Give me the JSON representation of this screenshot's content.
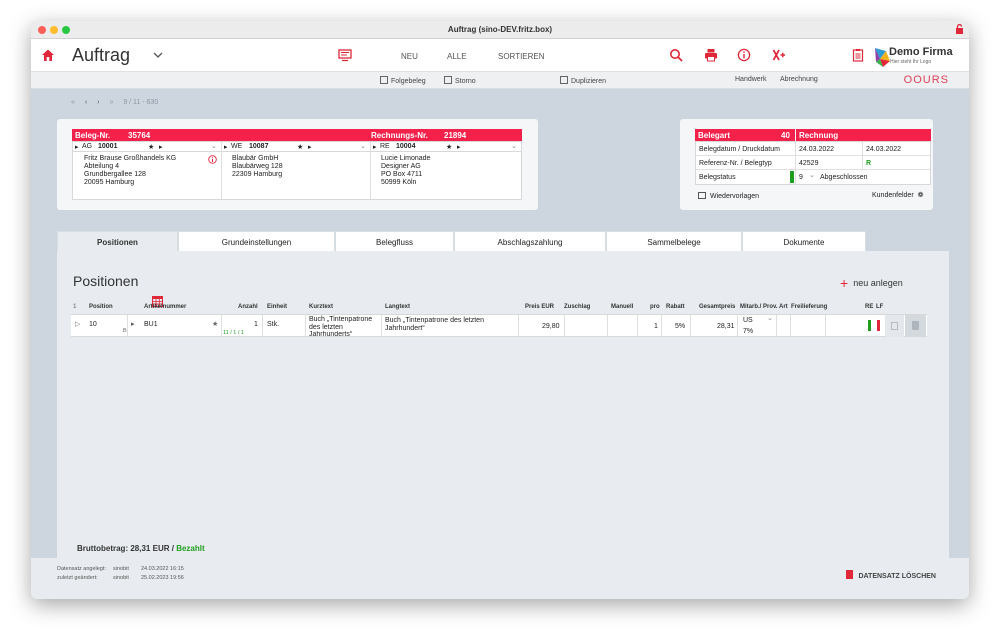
{
  "window": {
    "title": "Auftrag (sino-DEV.fritz.box)"
  },
  "toolbar": {
    "app_title": "Auftrag",
    "neu": "NEU",
    "alle": "ALLE",
    "sortieren": "SORTIEREN",
    "logo_name": "Demo Firma",
    "logo_tagline": "Hier steht Ihr Logo"
  },
  "subbar": {
    "folgebeleg": "Folgebeleg",
    "storno": "Storno",
    "duplizieren": "Duplizieren",
    "handwerk": "Handwerk",
    "abrechnung": "Abrechnung",
    "brand": "OOURS"
  },
  "pager": {
    "counter": "9 / 11 - 630"
  },
  "beleg": {
    "beleg_label": "Beleg-Nr.",
    "beleg_nr": "35764",
    "rechnung_label": "Rechnungs-Nr.",
    "rechnung_nr": "21894"
  },
  "addresses": [
    {
      "role": "AG",
      "number": "10001",
      "lines": [
        "Fritz Brause Großhandels KG",
        "Abteilung 4",
        "Grundbergallee 128",
        "20095 Hamburg"
      ]
    },
    {
      "role": "WE",
      "number": "10087",
      "lines": [
        "Blaubär GmbH",
        "Blaubärweg 128",
        "22309 Hamburg"
      ]
    },
    {
      "role": "RE",
      "number": "10004",
      "lines": [
        "Lucie Limonade",
        "Designer AG",
        "PO Box 4711",
        "50999 Köln"
      ]
    }
  ],
  "belegart": {
    "label": "Belegart",
    "number": "40",
    "type": "Rechnung",
    "datum_label": "Belegdatum / Druckdatum",
    "belegdatum": "24.03.2022",
    "druckdatum": "24.03.2022",
    "ref_label": "Referenz-Nr. / Belegtyp",
    "ref_nr": "42529",
    "belegtyp": "R",
    "status_label": "Belegstatus",
    "status_value": "9",
    "status_text": "Abgeschlossen",
    "wiedervorlagen": "Wiedervorlagen",
    "kundenfelder": "Kundenfelder"
  },
  "tabs": [
    "Positionen",
    "Grundeinstellungen",
    "Belegfluss",
    "Abschlagszahlung",
    "Sammelbelege",
    "Dokumente"
  ],
  "positions": {
    "title": "Positionen",
    "new_label": "neu anlegen",
    "columns": [
      "1",
      "Position",
      "Artikelnummer",
      "Anzahl",
      "Einheit",
      "Kurztext",
      "Langtext",
      "Preis EUR",
      "Zuschlag",
      "Manuell",
      "pro",
      "Rabatt",
      "Gesamtpreis",
      "Mitarb./ Prov.",
      "Art",
      "Freilieferung",
      "RE",
      "LF"
    ],
    "row": {
      "position": "10",
      "position_sub": "B",
      "artikel": "BU1",
      "anzahl": "1",
      "anzahl_sub": "11 / 1 / 1",
      "einheit": "Stk.",
      "kurztext_lines": [
        "Buch „Tintenpatrone",
        "des letzten",
        "Jahrhunderts“"
      ],
      "langtext_lines": [
        "Buch „Tintenpatrone des letzten",
        "Jahrhundert“"
      ],
      "preis": "29,80",
      "pro": "1",
      "rabatt": "5%",
      "gesamtpreis": "28,31",
      "mitarb": "US",
      "prov": "7%"
    }
  },
  "footer": {
    "brutto_label": "Bruttobetrag:",
    "brutto_value": "28,31",
    "currency": "EUR",
    "separator": "/",
    "status": "Bezahlt",
    "created_label": "Datensatz angelegt:",
    "created_user": "sinobit",
    "created_date": "24.03.2022 16:15",
    "changed_label": "zuletzt geändert:",
    "changed_user": "sinobit",
    "changed_date": "25.02.2023 19:56",
    "delete_label": "DATENSATZ LÖSCHEN"
  },
  "colors": {
    "accent": "#f4214b",
    "background": "#cdd5de",
    "ok_green": "#1e9e1e"
  }
}
